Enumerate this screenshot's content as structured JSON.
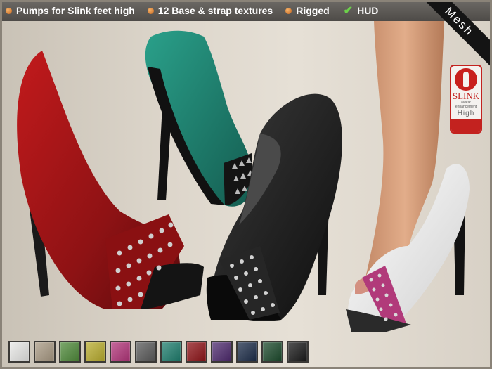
{
  "header": {
    "item1": "Pumps for Slink feet high",
    "item2": "12 Base & strap textures",
    "item3": "Rigged",
    "item4": "HUD"
  },
  "corner_label": "Mesh",
  "badge": {
    "brand": "SLINK",
    "tagline": "avatar enhancement",
    "variant": "High"
  },
  "shoes": [
    {
      "color": "red",
      "hex": "#9e1416"
    },
    {
      "color": "teal",
      "hex": "#1f7e6e"
    },
    {
      "color": "black",
      "hex": "#1c1c1c"
    },
    {
      "color": "white with pink strap",
      "hex": "#f2f2f2"
    }
  ],
  "swatches": [
    {
      "name": "white",
      "hex": "#e8e8e6"
    },
    {
      "name": "beige",
      "hex": "#a99a84"
    },
    {
      "name": "green",
      "hex": "#4f8a3a"
    },
    {
      "name": "yellow",
      "hex": "#b9ad2f"
    },
    {
      "name": "magenta",
      "hex": "#b2357a"
    },
    {
      "name": "grey",
      "hex": "#5a5a5a"
    },
    {
      "name": "teal",
      "hex": "#1f7e6e"
    },
    {
      "name": "red",
      "hex": "#8e1418"
    },
    {
      "name": "purple",
      "hex": "#4e2a6e"
    },
    {
      "name": "navy",
      "hex": "#1e2e4a"
    },
    {
      "name": "dark green",
      "hex": "#1c4a2c"
    },
    {
      "name": "black",
      "hex": "#1a1a1a"
    }
  ]
}
